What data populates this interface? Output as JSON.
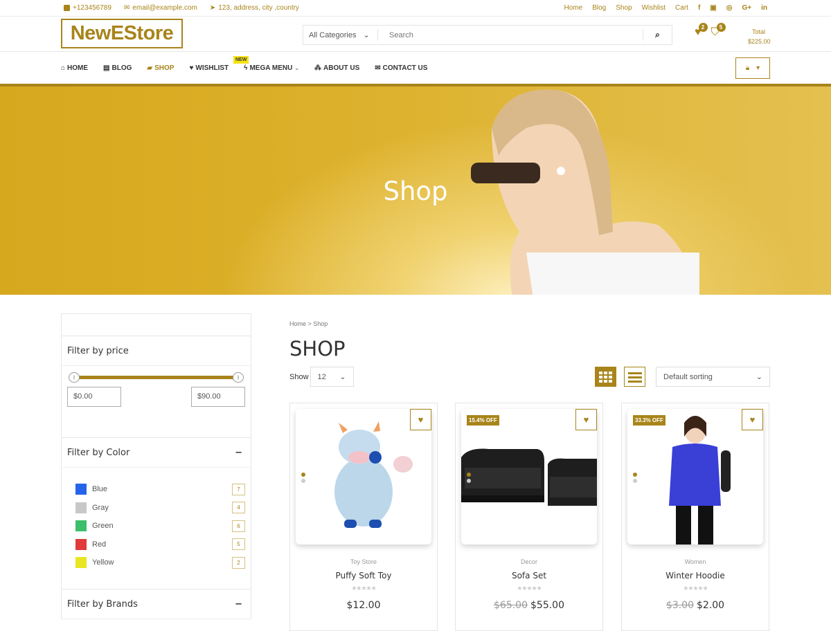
{
  "topbar": {
    "phone": "+123456789",
    "email": "email@example.com",
    "address": "123, address, city ,country",
    "links": [
      "Home",
      "Blog",
      "Shop",
      "Wishlist",
      "Cart"
    ],
    "social": [
      {
        "icon": "facebook-icon",
        "glyph": "f"
      },
      {
        "icon": "youtube-icon",
        "glyph": "▣"
      },
      {
        "icon": "instagram-icon",
        "glyph": "◎"
      },
      {
        "icon": "google-plus-icon",
        "glyph": "G+"
      },
      {
        "icon": "linkedin-icon",
        "glyph": "in"
      }
    ]
  },
  "header": {
    "logo": "NewEStore",
    "category_select": "All Categories",
    "search_placeholder": "Search",
    "wishlist_count": "2",
    "cart_count": "5",
    "total_label": "Total",
    "total_value": "$225.00"
  },
  "nav": {
    "items": [
      {
        "label": "HOME",
        "icon": "home-icon",
        "glyph": "⌂"
      },
      {
        "label": "BLOG",
        "icon": "document-icon",
        "glyph": "▤"
      },
      {
        "label": "SHOP",
        "icon": "shopping-bag-icon",
        "glyph": "▰"
      },
      {
        "label": "WISHLIST",
        "icon": "heart-icon",
        "glyph": "♥"
      },
      {
        "label": "MEGA MENU",
        "icon": "bolt-icon",
        "glyph": "ϟ"
      },
      {
        "label": "ABOUT US",
        "icon": "sitemap-icon",
        "glyph": "⁂"
      },
      {
        "label": "CONTACT US",
        "icon": "envelope-icon",
        "glyph": "✉"
      }
    ],
    "new_badge": "NEW",
    "active": "SHOP"
  },
  "hero": {
    "title": "Shop"
  },
  "sidebar": {
    "price_title": "Filter by price",
    "price_min": "$0.00",
    "price_max": "$90.00",
    "price_range_fraction": [
      0,
      1
    ],
    "color_title": "Filter by Color",
    "colors": [
      {
        "name": "Blue",
        "hex": "#2563eb",
        "count": "7"
      },
      {
        "name": "Gray",
        "hex": "#c8c8c8",
        "count": "4"
      },
      {
        "name": "Green",
        "hex": "#3cbe6a",
        "count": "6"
      },
      {
        "name": "Red",
        "hex": "#e03a3a",
        "count": "5"
      },
      {
        "name": "Yellow",
        "hex": "#eae522",
        "count": "2"
      }
    ],
    "brands_title": "Filter by Brands",
    "collapse_symbol": "−"
  },
  "main": {
    "breadcrumb": "Home > Shop",
    "title": "SHOP",
    "show_label": "Show",
    "show_value": "12",
    "sort_value": "Default sorting",
    "products": [
      {
        "category": "Toy Store",
        "name": "Puffy Soft Toy",
        "old_price": "",
        "price": "$12.00",
        "discount": "",
        "stars": "★★★★★"
      },
      {
        "category": "Decor",
        "name": "Sofa Set",
        "old_price": "$65.00",
        "price": "$55.00",
        "discount": "15.4% OFF",
        "stars": "★★★★★"
      },
      {
        "category": "Women",
        "name": "Winter Hoodie",
        "old_price": "$3.00",
        "price": "$2.00",
        "discount": "33.3% OFF",
        "stars": "★★★★★"
      }
    ]
  },
  "colors": {
    "accent": "#a8841a",
    "hero": "#d6a81e",
    "new_badge": "#f7e216"
  }
}
